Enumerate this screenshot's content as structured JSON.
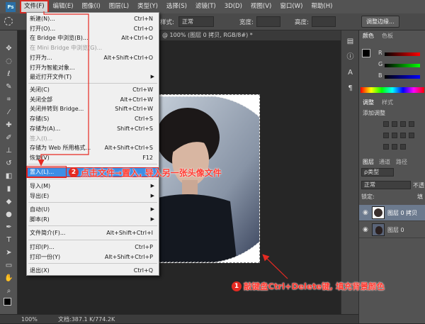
{
  "menubar": {
    "items": [
      "文件(F)",
      "编辑(E)",
      "图像(I)",
      "图层(L)",
      "类型(Y)",
      "选择(S)",
      "滤镜(T)",
      "3D(D)",
      "视图(V)",
      "窗口(W)",
      "帮助(H)"
    ],
    "app_icon": "Ps"
  },
  "options": {
    "style_label": "样式:",
    "style_value": "正常",
    "width_label": "宽度:",
    "height_label": "高度:",
    "refine_button": "调整边缘..."
  },
  "document": {
    "tab_title": "@ 100% (图层 0 拷贝, RGB/8#) *"
  },
  "status": {
    "zoom": "100%",
    "doc_info": "文档:387.1 K/774.2K"
  },
  "file_menu": {
    "items": [
      {
        "label": "新建(N)...",
        "shortcut": "Ctrl+N"
      },
      {
        "label": "打开(O)...",
        "shortcut": "Ctrl+O"
      },
      {
        "label": "在 Bridge 中浏览(B)...",
        "shortcut": "Alt+Ctrl+O"
      },
      {
        "label": "在 Mini Bridge 中浏览(G)...",
        "shortcut": ""
      },
      {
        "label": "打开为...",
        "shortcut": "Alt+Shift+Ctrl+O"
      },
      {
        "label": "打开为智能对象...",
        "shortcut": ""
      },
      {
        "label": "最近打开文件(T)",
        "shortcut": ""
      },
      {
        "label": "关闭(C)",
        "shortcut": "Ctrl+W"
      },
      {
        "label": "关闭全部",
        "shortcut": "Alt+Ctrl+W"
      },
      {
        "label": "关闭并转到 Bridge...",
        "shortcut": "Shift+Ctrl+W"
      },
      {
        "label": "存储(S)",
        "shortcut": "Ctrl+S"
      },
      {
        "label": "存储为(A)...",
        "shortcut": "Shift+Ctrl+S"
      },
      {
        "label": "签入(I)...",
        "shortcut": ""
      },
      {
        "label": "存储为 Web 所用格式...",
        "shortcut": "Alt+Shift+Ctrl+S"
      },
      {
        "label": "恢复(V)",
        "shortcut": "F12"
      },
      {
        "label": "置入(L)...",
        "shortcut": ""
      },
      {
        "label": "导入(M)",
        "shortcut": ""
      },
      {
        "label": "导出(E)",
        "shortcut": ""
      },
      {
        "label": "自动(U)",
        "shortcut": ""
      },
      {
        "label": "脚本(R)",
        "shortcut": ""
      },
      {
        "label": "文件简介(F)...",
        "shortcut": "Alt+Shift+Ctrl+I"
      },
      {
        "label": "打印(P)...",
        "shortcut": "Ctrl+P"
      },
      {
        "label": "打印一份(Y)",
        "shortcut": "Alt+Shift+Ctrl+P"
      },
      {
        "label": "退出(X)",
        "shortcut": "Ctrl+Q"
      }
    ]
  },
  "panels": {
    "color_tab": "颜色",
    "swatches_tab": "色板",
    "channels": [
      "R",
      "G",
      "B"
    ],
    "adjust_tab": "调整",
    "styles_tab": "样式",
    "add_adjust": "添加调整",
    "layers_tab": "图层",
    "channels_tab": "通道",
    "paths_tab": "路径",
    "kind_filter": "ρ类型",
    "blend_mode": "正常",
    "opacity_short": "不透",
    "lock_label": "锁定:",
    "fill_short": "填",
    "layers": [
      "图层 0 拷贝",
      "图层 0"
    ]
  },
  "annotations": {
    "step2_num": "2",
    "step2_text": "点击文件→置入, 导入另一张头像文件",
    "step1_num": "1",
    "step1_text": "敲键盘Ctrl+Delete键, 填充背景颜色"
  },
  "colors": {
    "accent_red": "#e52a22",
    "menu_highlight": "#3d8ee6"
  }
}
